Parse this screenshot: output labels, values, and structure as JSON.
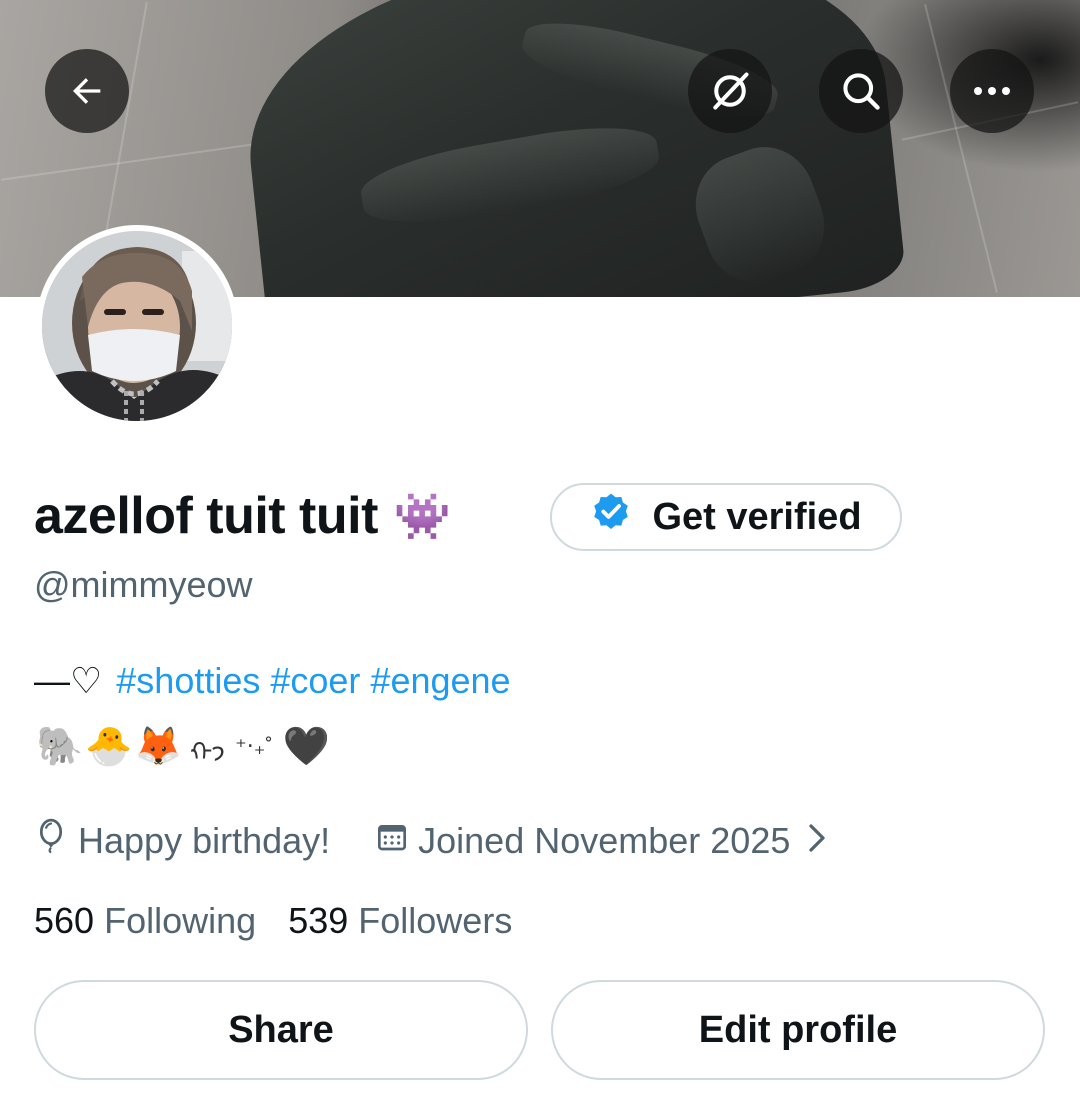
{
  "header": {
    "back_icon": "arrow-left-icon",
    "grok_icon": "grok-icon",
    "search_icon": "search-icon",
    "more_icon": "more-horizontal-icon"
  },
  "profile": {
    "display_name": "azellof tuit tuit",
    "name_emoji": "👾",
    "handle": "@mimmyeow",
    "bio_prefix": "—♡",
    "bio_hashtags": "#shotties #coer #engene",
    "bio_emojis": [
      "🐘",
      "🐣",
      "🦊",
      "ᡣ𐭩",
      "⁺‧₊˚",
      "🖤"
    ]
  },
  "verify_button": {
    "label": "Get verified",
    "icon": "verified-badge-icon",
    "badge_color": "#1d9bf0"
  },
  "meta": {
    "birthday": "Happy birthday!",
    "joined": "Joined November 2025"
  },
  "stats": {
    "following_count": "560",
    "following_label": "Following",
    "followers_count": "539",
    "followers_label": "Followers"
  },
  "actions": {
    "share_label": "Share",
    "edit_label": "Edit profile"
  },
  "colors": {
    "link": "#1d9bf0",
    "secondary_text": "#536471",
    "primary_text": "#0f1419",
    "border": "#cfd9de"
  }
}
